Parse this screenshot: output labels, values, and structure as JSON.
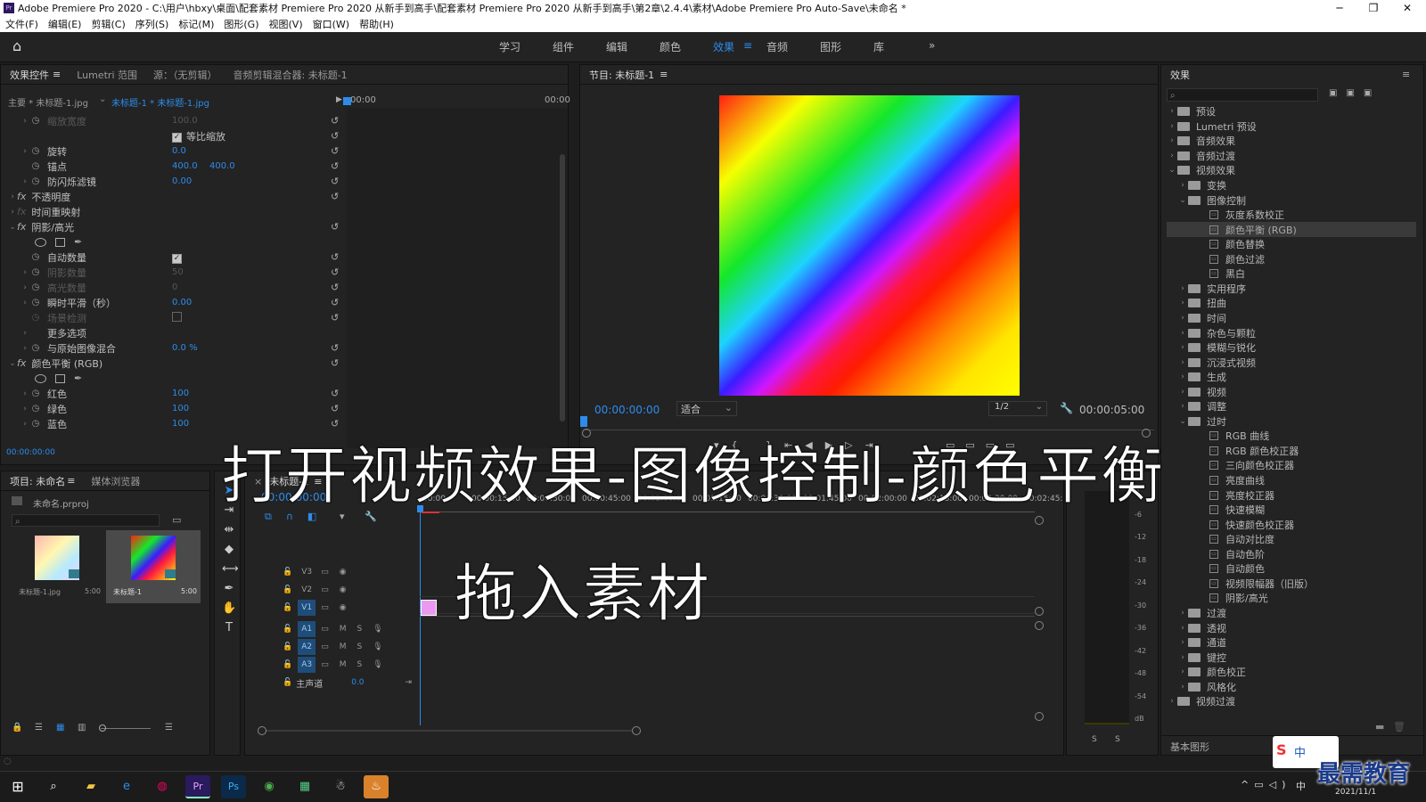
{
  "window": {
    "title": "Adobe Premiere Pro 2020 - C:\\用户\\hbxy\\桌面\\配套素材 Premiere Pro 2020 从新手到高手\\配套素材 Premiere Pro 2020 从新手到高手\\第2章\\2.4.4\\素材\\Adobe Premiere Pro Auto-Save\\未命名 *",
    "minimize": "─",
    "maximize": "❐",
    "close": "✕"
  },
  "menu": [
    "文件(F)",
    "编辑(E)",
    "剪辑(C)",
    "序列(S)",
    "标记(M)",
    "图形(G)",
    "视图(V)",
    "窗口(W)",
    "帮助(H)"
  ],
  "workspaces": [
    "学习",
    "组件",
    "编辑",
    "颜色",
    "效果",
    "音频",
    "图形",
    "库"
  ],
  "workspace_more": "»",
  "effect_controls": {
    "tabs": [
      "效果控件",
      "Lumetri 范围",
      "源：（无剪辑）",
      "音频剪辑混合器: 未标题-1"
    ],
    "master_clip": "主要 * 未标题-1.jpg",
    "sequence_clip": "未标题-1 * 未标题-1.jpg",
    "time_start": "00:00",
    "time_end": "00:00",
    "current_time": "00:00:00:00",
    "rows": [
      {
        "label": "缩放宽度",
        "value": "100.0"
      },
      {
        "label": "等比缩放"
      },
      {
        "label": "旋转",
        "value": "0.0"
      },
      {
        "label": "锚点",
        "value": "400.0",
        "value2": "400.0"
      },
      {
        "label": "防闪烁滤镜",
        "value": "0.00"
      },
      {
        "label": "不透明度"
      },
      {
        "label": "时间重映射"
      },
      {
        "label": "阴影/高光"
      },
      {
        "label": "自动数量"
      },
      {
        "label": "阴影数量",
        "value": "50"
      },
      {
        "label": "高光数量",
        "value": "0"
      },
      {
        "label": "瞬时平滑（秒）",
        "value": "0.00"
      },
      {
        "label": "场景检测"
      },
      {
        "label": "更多选项"
      },
      {
        "label": "与原始图像混合",
        "value": "0.0 %"
      },
      {
        "label": "颜色平衡 (RGB)"
      },
      {
        "label": "红色",
        "value": "100"
      },
      {
        "label": "绿色",
        "value": "100"
      },
      {
        "label": "蓝色",
        "value": "100"
      }
    ]
  },
  "program_monitor": {
    "title": "节目: 未标题-1",
    "timecode": "00:00:00:00",
    "fit": "适合",
    "quality": "1/2",
    "duration": "00:00:05:00"
  },
  "project": {
    "tabs": [
      "项目: 未命名",
      "媒体浏览器"
    ],
    "file": "未命名.prproj",
    "items": [
      {
        "name": "未标题-1.jpg",
        "duration": "5:00"
      },
      {
        "name": "未标题-1",
        "duration": "5:00"
      }
    ]
  },
  "timeline": {
    "tab": "未标题-1",
    "timecode": "00:00:00:00",
    "ruler": [
      ":00:00",
      "00:00:15:00",
      "00:00:30:00",
      "00:00:45:00",
      "00:01:00:00",
      "00:01:15:00",
      "00:01:30:00",
      "00:01:45:00",
      "00:02:00:00",
      "00:02:15:00",
      "00:02:30:00",
      "00:02:45:"
    ],
    "video_tracks": [
      "V3",
      "V2",
      "V1"
    ],
    "audio_tracks": [
      "A1",
      "A2",
      "A3"
    ],
    "master": "主声道",
    "master_value": "0.0",
    "m": "M",
    "s": "S"
  },
  "audio_meter": {
    "scale": [
      "0",
      "-6",
      "-12",
      "-18",
      "-24",
      "-30",
      "-36",
      "-42",
      "-48",
      "-54",
      "dB"
    ],
    "solo": "S"
  },
  "effects_panel": {
    "title": "效果",
    "tree": [
      {
        "label": "预设"
      },
      {
        "label": "Lumetri 预设"
      },
      {
        "label": "音频效果"
      },
      {
        "label": "音频过渡"
      },
      {
        "label": "视频效果"
      },
      {
        "label": "变换"
      },
      {
        "label": "图像控制"
      },
      {
        "label": "灰度系数校正"
      },
      {
        "label": "颜色平衡 (RGB)"
      },
      {
        "label": "颜色替换"
      },
      {
        "label": "颜色过滤"
      },
      {
        "label": "黑白"
      },
      {
        "label": "实用程序"
      },
      {
        "label": "扭曲"
      },
      {
        "label": "时间"
      },
      {
        "label": "杂色与颗粒"
      },
      {
        "label": "模糊与锐化"
      },
      {
        "label": "沉浸式视频"
      },
      {
        "label": "生成"
      },
      {
        "label": "视频"
      },
      {
        "label": "调整"
      },
      {
        "label": "过时"
      },
      {
        "label": "RGB 曲线"
      },
      {
        "label": "RGB 颜色校正器"
      },
      {
        "label": "三向颜色校正器"
      },
      {
        "label": "亮度曲线"
      },
      {
        "label": "亮度校正器"
      },
      {
        "label": "快速模糊"
      },
      {
        "label": "快速颜色校正器"
      },
      {
        "label": "自动对比度"
      },
      {
        "label": "自动色阶"
      },
      {
        "label": "自动颜色"
      },
      {
        "label": "视频限幅器（旧版）"
      },
      {
        "label": "阴影/高光"
      },
      {
        "label": "过渡"
      },
      {
        "label": "透视"
      },
      {
        "label": "通道"
      },
      {
        "label": "键控"
      },
      {
        "label": "颜色校正"
      },
      {
        "label": "风格化"
      },
      {
        "label": "视频过渡"
      }
    ],
    "essential_graphics": "基本图形"
  },
  "overlays": {
    "line1": "打开视频效果-图像控制-颜色平衡",
    "line2": "拖入素材"
  },
  "taskbar": {
    "time": "2021/11/1",
    "ime": "中",
    "watermark": "最需教育"
  }
}
